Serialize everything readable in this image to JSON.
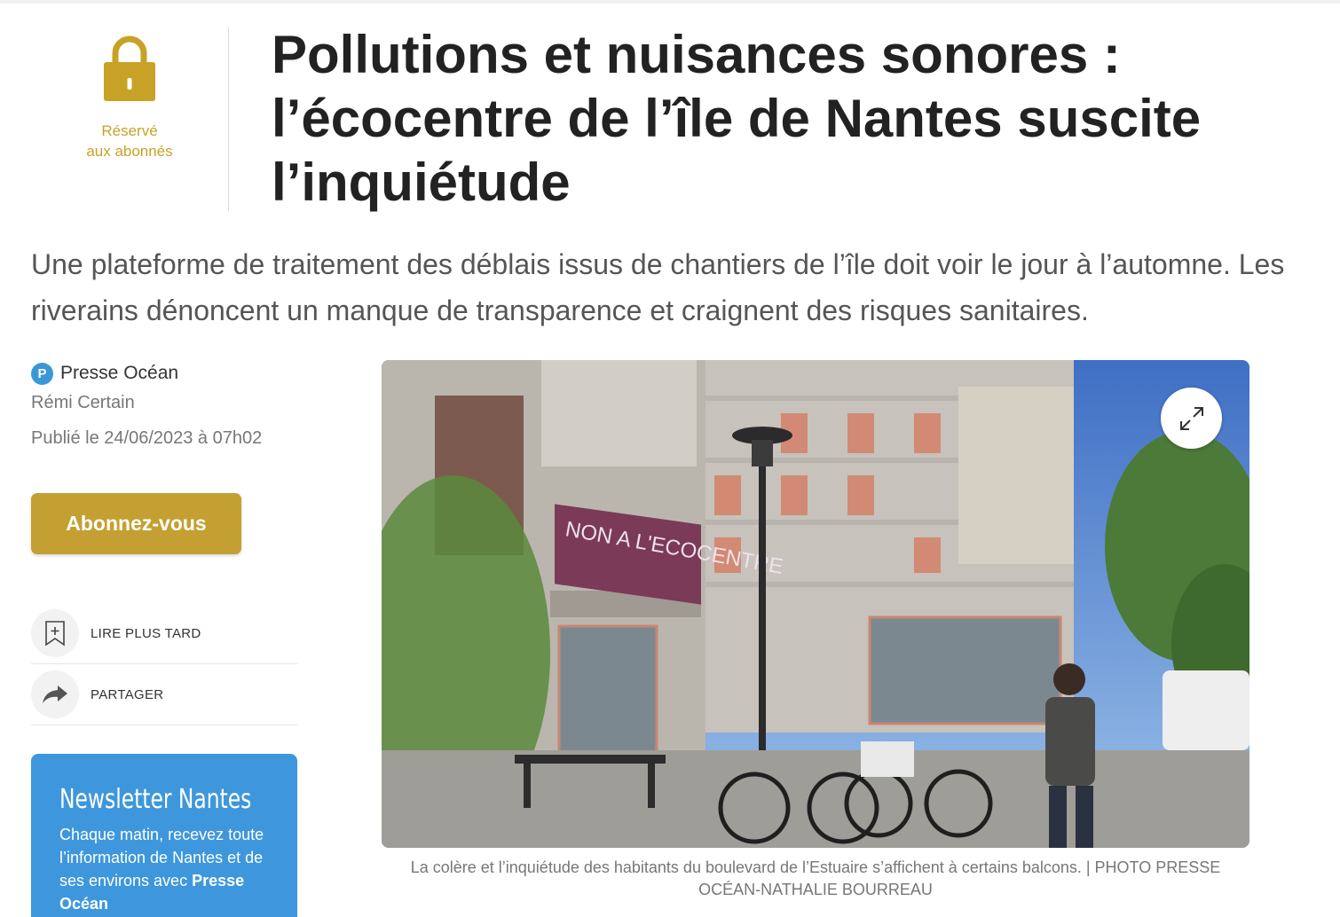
{
  "premium": {
    "label_line1": "Réservé",
    "label_line2": "aux abonnés"
  },
  "article": {
    "title": "Pollutions et nuisances sonores : l’écocentre de l’île de Nantes suscite l’inquiétude",
    "chapo": "Une plateforme de traitement des déblais issus de chantiers de l’île doit voir le jour à l’automne. Les riverains dénoncent un manque de transparence et craignent des risques sanitaires."
  },
  "meta": {
    "source_logo_letter": "P",
    "source": "Presse Océan",
    "author": "Rémi Certain",
    "published": "Publié le 24/06/2023 à 07h02"
  },
  "subscribe_button": "Abonnez-vous",
  "actions": [
    {
      "label": "LIRE PLUS TARD",
      "icon": "bookmark-add-icon"
    },
    {
      "label": "PARTAGER",
      "icon": "share-arrow-icon"
    }
  ],
  "newsletter": {
    "title": "Newsletter Nantes",
    "text": "Chaque matin, recevez toute l’information de Nantes et de ses environs avec",
    "brand": "Presse Océan"
  },
  "photo": {
    "banner_text": "NON A L'ECOCENTRE",
    "caption": "La colère et l’inquiétude des habitants du boulevard de l’Estuaire s’affichent à certains balcons. | PHOTO PRESSE OCÉAN-NATHALIE BOURREAU"
  },
  "colors": {
    "gold": "#c4a033",
    "newsletter_blue": "#3e97dc",
    "source_blue": "#3a97d8"
  }
}
